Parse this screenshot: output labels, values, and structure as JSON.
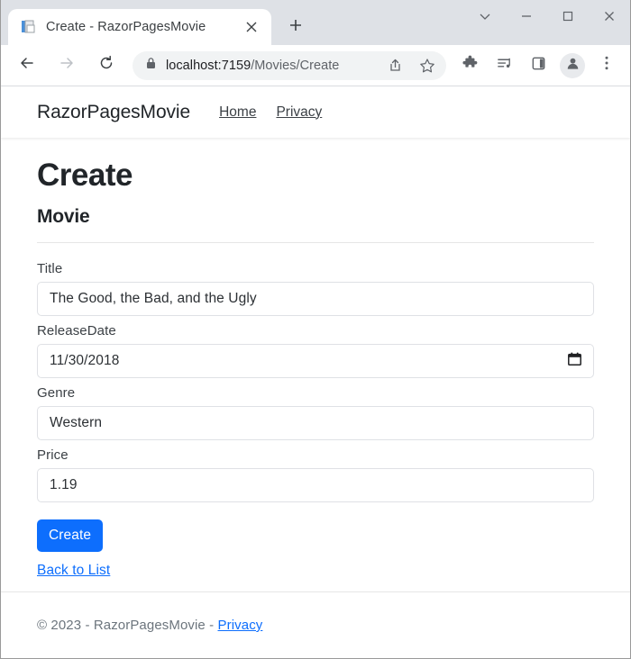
{
  "browser": {
    "tab": {
      "title": "Create - RazorPagesMovie",
      "favicon_icon": "page-document-icon",
      "close_icon": "close-icon"
    },
    "new_tab_icon": "plus-icon",
    "window_controls": [
      {
        "name": "tab-search",
        "icon": "chevron-down-icon"
      },
      {
        "name": "minimize",
        "icon": "minimize-icon"
      },
      {
        "name": "maximize",
        "icon": "maximize-icon"
      },
      {
        "name": "close",
        "icon": "close-icon"
      }
    ],
    "toolbar": {
      "back_icon": "arrow-left-icon",
      "forward_icon": "arrow-right-icon",
      "reload_icon": "reload-icon",
      "lock_icon": "lock-icon",
      "url_host": "localhost:7159",
      "url_path": "/Movies/Create",
      "share_icon": "share-icon",
      "bookmark_icon": "star-icon",
      "extensions_icon": "puzzle-icon",
      "media_icon": "media-playlist-icon",
      "side_panel_icon": "side-panel-icon",
      "profile_icon": "person-avatar-icon",
      "menu_icon": "three-dot-menu-icon"
    }
  },
  "site": {
    "brand": "RazorPagesMovie",
    "nav_links": [
      {
        "label": "Home"
      },
      {
        "label": "Privacy"
      }
    ]
  },
  "page": {
    "title": "Create",
    "subtitle": "Movie",
    "fields": [
      {
        "label": "Title",
        "value": "The Good, the Bad, and the Ugly",
        "type": "text"
      },
      {
        "label": "ReleaseDate",
        "value": "11/30/2018",
        "type": "date",
        "picker_icon": "calendar-icon"
      },
      {
        "label": "Genre",
        "value": "Western",
        "type": "text"
      },
      {
        "label": "Price",
        "value": "1.19",
        "type": "text"
      }
    ],
    "submit_label": "Create",
    "back_link_label": "Back to List"
  },
  "footer": {
    "copyright": "© 2023 - RazorPagesMovie - ",
    "privacy_label": "Privacy"
  },
  "colors": {
    "primary": "#0d6efd",
    "link": "#0d6efd",
    "tabstrip": "#dee1e6",
    "omnibox": "#f1f3f4"
  }
}
